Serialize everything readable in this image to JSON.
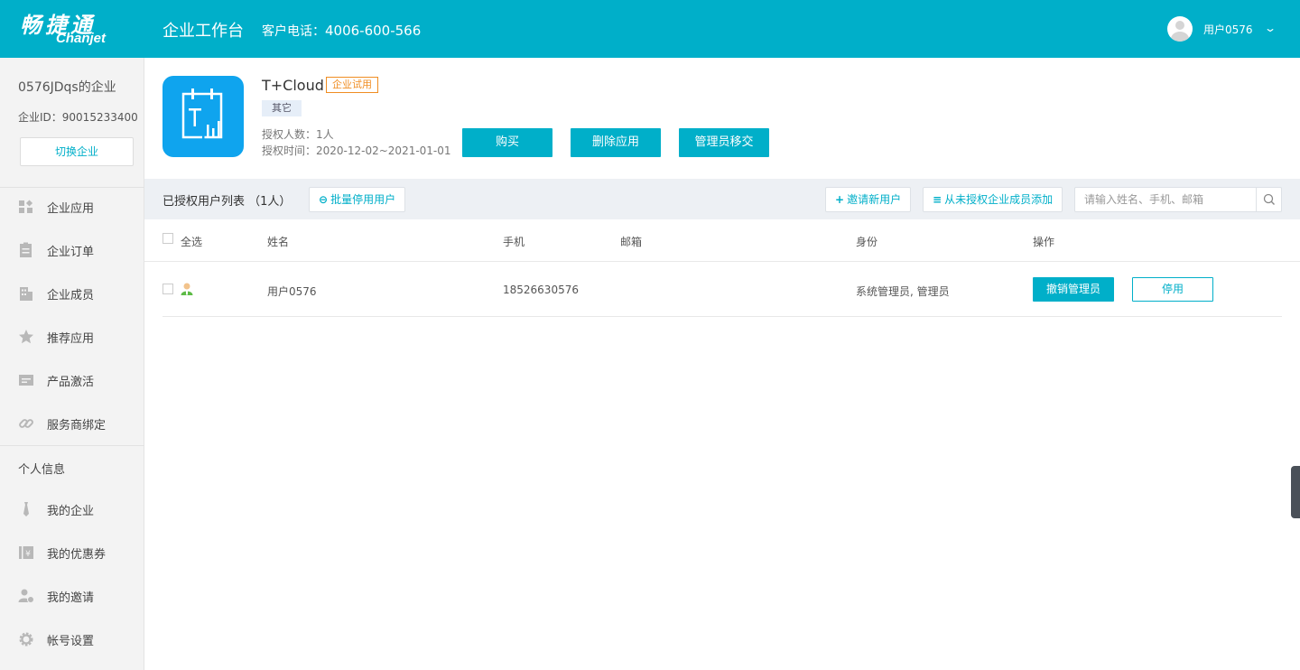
{
  "header": {
    "logo_cn": "畅捷通",
    "logo_en": "Chanjet",
    "title": "企业工作台",
    "phone_label": "客户电话：",
    "phone_number": "4006-600-566",
    "user_name": "用户0576",
    "chevron": "⌄"
  },
  "sidebar": {
    "company_name": "0576JDqs的企业",
    "company_id": "企业ID：90015233400",
    "switch_label": "切换企业",
    "items": [
      {
        "label": "企业应用",
        "icon": "apps-icon"
      },
      {
        "label": "企业订单",
        "icon": "order-icon"
      },
      {
        "label": "企业成员",
        "icon": "building-icon"
      },
      {
        "label": "推荐应用",
        "icon": "star-icon"
      },
      {
        "label": "产品激活",
        "icon": "activation-icon"
      },
      {
        "label": "服务商绑定",
        "icon": "link-icon"
      }
    ],
    "section_label": "个人信息",
    "personal_items": [
      {
        "label": "我的企业",
        "icon": "tie-icon"
      },
      {
        "label": "我的优惠券",
        "icon": "coupon-icon"
      },
      {
        "label": "我的邀请",
        "icon": "invite-icon"
      },
      {
        "label": "帐号设置",
        "icon": "gear-icon"
      }
    ]
  },
  "app": {
    "name": "T+Cloud",
    "badge": "企业试用",
    "category": "其它",
    "auth_count": "授权人数：1人",
    "auth_time": "授权时间：2020-12-02~2021-01-01",
    "buy_label": "购买",
    "delete_label": "删除应用",
    "transfer_label": "管理员移交",
    "icon_color": "#0fa4ee"
  },
  "toolbar": {
    "list_title": "已授权用户列表 （1人）",
    "batch_disable_label": "批量停用用户",
    "invite_label": "邀请新用户",
    "add_from_label": "从未授权企业成员添加",
    "search_placeholder": "请输入姓名、手机、邮箱"
  },
  "table": {
    "headers": {
      "select_all": "全选",
      "name": "姓名",
      "phone": "手机",
      "email": "邮箱",
      "role": "身份",
      "actions": "操作"
    },
    "rows": [
      {
        "name": "用户0576",
        "phone": "18526630576",
        "email": "",
        "role": "系统管理员, 管理员",
        "revoke_label": "撤销管理员",
        "disable_label": "停用"
      }
    ]
  },
  "colors": {
    "accent": "#00afc9",
    "badge_orange": "#f08d22"
  }
}
